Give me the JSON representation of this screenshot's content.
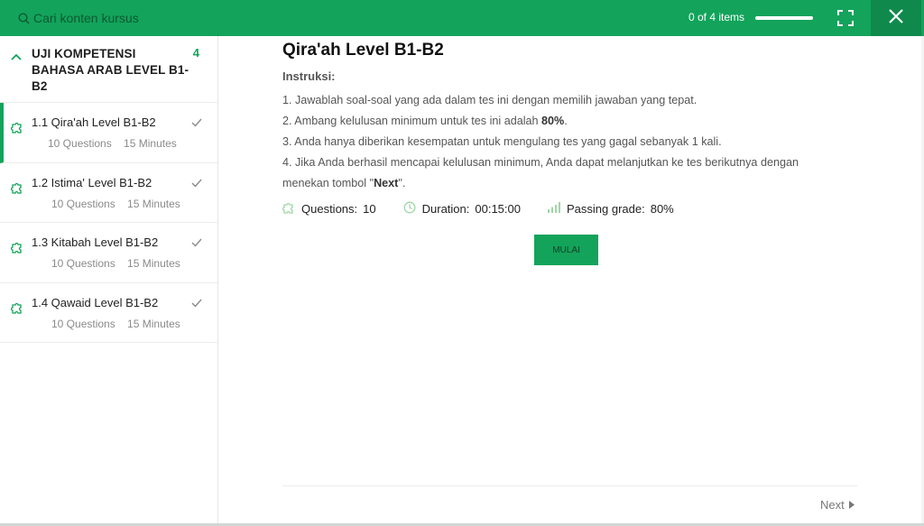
{
  "header": {
    "search_placeholder": "Cari konten kursus",
    "progress_text": "0 of 4 items",
    "progress_fraction": 1.0,
    "accent": "#13a35b"
  },
  "sidebar": {
    "section_title": "UJI KOMPETENSI BAHASA ARAB LEVEL B1-B2",
    "section_count": "4",
    "lessons": [
      {
        "title": "1.1  Qira'ah Level B1-B2",
        "meta": "10 Questions    15 Minutes",
        "active": true
      },
      {
        "title": "1.2  Istima' Level B1-B2",
        "meta": "10 Questions    15 Minutes",
        "active": false
      },
      {
        "title": "1.3  Kitabah Level B1-B2",
        "meta": "10 Questions    15 Minutes",
        "active": false
      },
      {
        "title": "1.4  Qawaid Level B1-B2",
        "meta": "10 Questions    15 Minutes",
        "active": false
      }
    ]
  },
  "main": {
    "title": "Qira'ah Level B1-B2",
    "instructions_label": "Instruksi:",
    "instructions": {
      "line1": "1. Jawablah soal-soal yang ada dalam tes ini dengan memilih jawaban yang tepat.",
      "line2_pre": "2. Ambang kelulusan minimum untuk tes ini adalah ",
      "line2_bold": "80%",
      "line2_post": ".",
      "line3": "3. Anda hanya diberikan kesempatan untuk mengulang tes yang gagal sebanyak 1 kali.",
      "line4_pre": "4. Jika Anda berhasil mencapai kelulusan minimum, Anda dapat melanjutkan ke tes berikutnya dengan menekan tombol \"",
      "line4_bold": "Next",
      "line4_post": "\"."
    },
    "stats": {
      "questions_label": "Questions:",
      "questions_value": "10",
      "duration_label": "Duration:",
      "duration_value": "00:15:00",
      "passing_label": "Passing grade:",
      "passing_value": "80%"
    },
    "start_button": "MULAI",
    "next_label": "Next"
  }
}
